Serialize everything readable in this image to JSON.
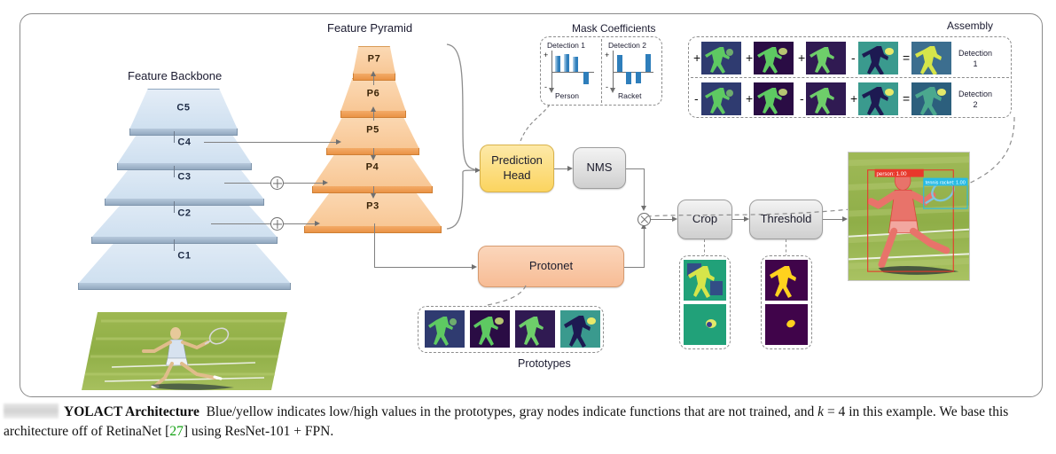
{
  "figure": {
    "backbone_title": "Feature Backbone",
    "pyramid_title": "Feature Pyramid",
    "mask_coeff_title": "Mask Coefficients",
    "assembly_title": "Assembly",
    "prototypes_title": "Prototypes"
  },
  "backbone": {
    "layers": [
      {
        "label": "C5"
      },
      {
        "label": "C4"
      },
      {
        "label": "C3"
      },
      {
        "label": "C2"
      },
      {
        "label": "C1"
      }
    ]
  },
  "pyramid": {
    "layers": [
      {
        "label": "P7"
      },
      {
        "label": "P6"
      },
      {
        "label": "P5"
      },
      {
        "label": "P4"
      },
      {
        "label": "P3"
      }
    ]
  },
  "nodes": {
    "prediction_head": "Prediction\nHead",
    "prediction_head_line1": "Prediction",
    "prediction_head_line2": "Head",
    "nms": "NMS",
    "protonet": "Protonet",
    "crop": "Crop",
    "threshold": "Threshold"
  },
  "operators": {
    "add1": "⊕",
    "add2": "⊕",
    "multiply": "⊗"
  },
  "mask_coefficients": {
    "detections": [
      {
        "title": "Detection 1",
        "class_label": "Person",
        "plus_sign": "+",
        "minus_sign": "-",
        "bars": [
          0.82,
          0.9,
          0.78,
          -0.62
        ]
      },
      {
        "title": "Detection 2",
        "class_label": "Racket",
        "plus_sign": "+",
        "minus_sign": "-",
        "bars": [
          0.85,
          -0.6,
          -0.58,
          0.88
        ]
      }
    ]
  },
  "assembly": {
    "rows": [
      {
        "result_label_line1": "Detection",
        "result_label_line2": "1",
        "signs": [
          "+",
          "+",
          "+",
          "-",
          "="
        ]
      },
      {
        "result_label_line1": "Detection",
        "result_label_line2": "2",
        "signs": [
          "-",
          "+",
          "-",
          "+",
          "="
        ]
      }
    ]
  },
  "output_image": {
    "person_box_label": "person: 1.00",
    "racket_box_label": "tennis racket: 1.00",
    "person_box_color": "#e8382b",
    "racket_box_color": "#27bbe6"
  },
  "caption": {
    "redacted_prefix": "",
    "bold_title": "YOLACT Architecture",
    "text_part1": "Blue/yellow indicates low/high values in the prototypes, gray nodes indicate functions that are not trained, and ",
    "math_k": "k",
    "math_eq": " = 4",
    "text_part2": " in this example. We base this architecture off of RetinaNet [",
    "reference": "27",
    "text_part3": "] using ResNet-101 + FPN."
  },
  "colors": {
    "backbone_plate": "#cfe0f0",
    "pyramid_plate": "#f8c795",
    "prediction_head": "#fbd45f",
    "gray_node": "#cfcfcf",
    "protonet": "#f7bc95",
    "bar_blue": "#2e7ebb",
    "reference_green": "#13a113"
  }
}
